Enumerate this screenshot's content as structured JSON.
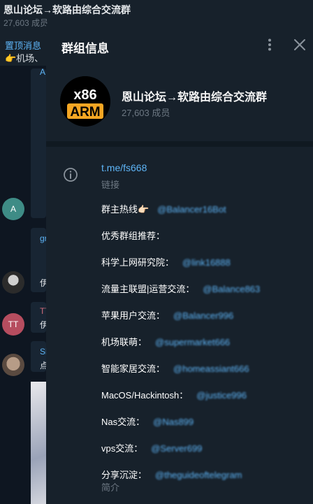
{
  "window": {
    "title": "恩山论坛→软路由综合交流群",
    "members": "27,603 成员"
  },
  "pinned": {
    "title": "置顶消息",
    "text": "👉机场、"
  },
  "chat_fragments": {
    "frag_a": "A",
    "frag_gr": "gr",
    "frag_b1": "伊",
    "frag_tt": "TT",
    "frag_b2": "伊",
    "frag_si": "Si",
    "frag_b3": "点"
  },
  "avatars": {
    "a": "A",
    "tt": "TT"
  },
  "dialog": {
    "title": "群组信息",
    "group_name": "恩山论坛→软路由综合交流群",
    "members": "27,603 成员",
    "logo_top": "x86",
    "logo_bottom": "ARM",
    "link": "t.me/fs668",
    "link_caption": "链接",
    "bio_caption": "简介",
    "bio_lines": [
      {
        "label": "群主热线👉🏻",
        "mention": "@Balancer16Bot"
      },
      {
        "label": "优秀群组推荐：",
        "mention": ""
      },
      {
        "label": "科学上网研究院：",
        "mention": "@link16888"
      },
      {
        "label": "流量主联盟|运营交流：",
        "mention": "@Balance863"
      },
      {
        "label": "苹果用户交流：",
        "mention": "@Balancer996"
      },
      {
        "label": "机场联萌：",
        "mention": "@supermarket666"
      },
      {
        "label": "智能家居交流：",
        "mention": "@homeassiant666"
      },
      {
        "label": "MacOS/Hackintosh：",
        "mention": "@justice996"
      },
      {
        "label": "Nas交流：",
        "mention": "@Nas899"
      },
      {
        "label": "vps交流：",
        "mention": "@Server699"
      },
      {
        "label": "分享沉淀：",
        "mention": "@theguideoftelegram"
      }
    ]
  },
  "icons": {
    "more": "more-vertical-icon",
    "close": "close-icon",
    "info": "info-icon"
  },
  "colors": {
    "panel": "#17212b",
    "accent": "#5eb5f7",
    "muted": "#6d7883",
    "logo_orange": "#f5a623"
  }
}
